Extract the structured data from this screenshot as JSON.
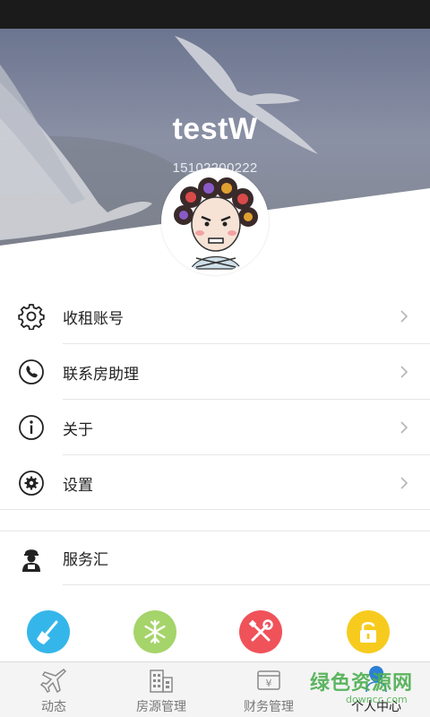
{
  "profile": {
    "username": "testW",
    "phone": "15102200222"
  },
  "menu": {
    "items": [
      {
        "label": "收租账号",
        "icon": "gear-icon"
      },
      {
        "label": "联系房助理",
        "icon": "phone-icon"
      },
      {
        "label": "关于",
        "icon": "info-icon"
      },
      {
        "label": "设置",
        "icon": "settings-icon"
      }
    ],
    "service": {
      "label": "服务汇",
      "icon": "service-person-icon"
    }
  },
  "quick_actions": [
    {
      "name": "cleaning",
      "icon": "broom-icon",
      "color": "#35b6ea"
    },
    {
      "name": "aircon",
      "icon": "snowflake-icon",
      "color": "#a5d46a"
    },
    {
      "name": "repair",
      "icon": "tools-icon",
      "color": "#f0525a"
    },
    {
      "name": "lock",
      "icon": "lock-icon",
      "color": "#f7cb1e"
    }
  ],
  "tabs": [
    {
      "label": "动态",
      "icon": "plane-icon",
      "active": false
    },
    {
      "label": "房源管理",
      "icon": "building-icon",
      "active": false
    },
    {
      "label": "财务管理",
      "icon": "finance-icon",
      "active": false
    },
    {
      "label": "个人中心",
      "icon": "person-icon",
      "active": true
    }
  ],
  "watermark": {
    "title": "绿色资源网",
    "url": "downcc.com"
  },
  "colors": {
    "accent": "#2a7fd6",
    "text": "#222222",
    "divider": "#e6e6e6"
  }
}
